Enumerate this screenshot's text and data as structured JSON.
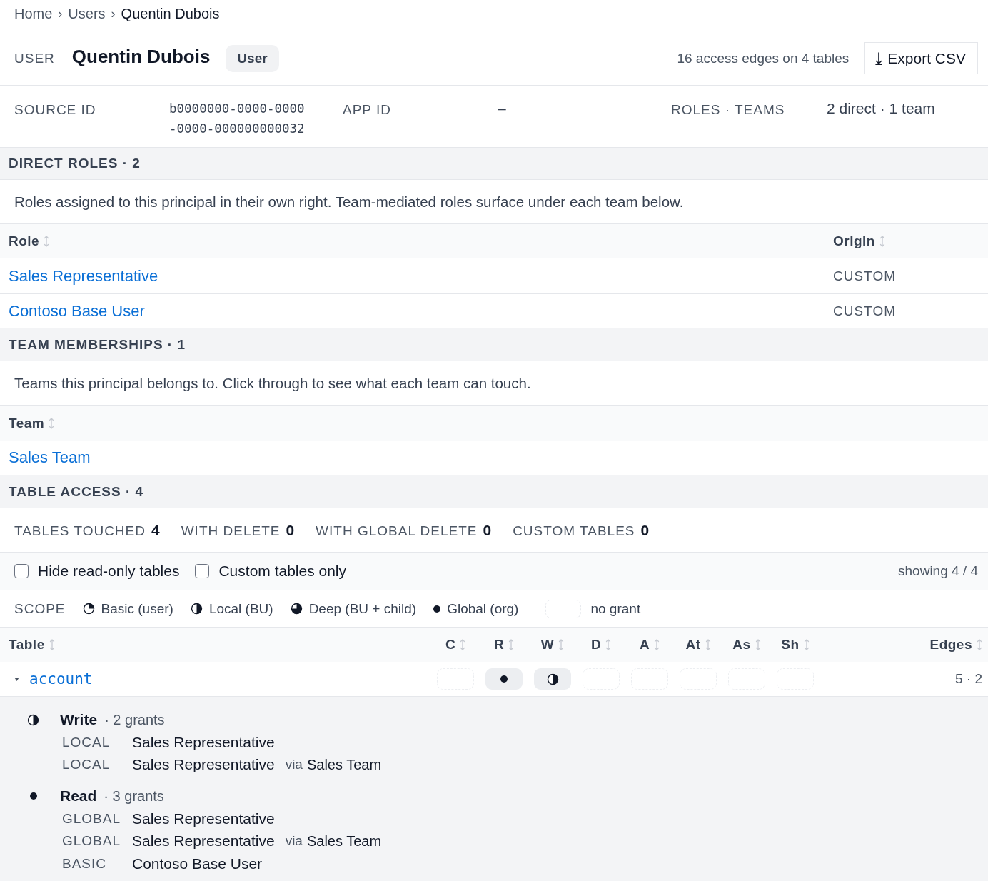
{
  "breadcrumb": [
    {
      "kind": "link",
      "label": "Home"
    },
    {
      "kind": "separator",
      "label": "›"
    },
    {
      "kind": "link",
      "label": "Users"
    },
    {
      "kind": "separator",
      "label": "›"
    },
    {
      "kind": "current",
      "label": "Quentin Dubois"
    }
  ],
  "header": {
    "type_label": "USER",
    "name": "Quentin Dubois",
    "badge": "User",
    "summary": "16 access edges on 4 tables",
    "export_button": "Export CSV"
  },
  "meta": [
    {
      "label": "SOURCE ID",
      "value": "b0000000-0000-0000-0000-000000000032",
      "kind": "mono"
    },
    {
      "label": "APP ID",
      "value": "–",
      "kind": "text"
    },
    {
      "label": "ROLES · TEAMS",
      "value": "2 direct · 1 team",
      "kind": "text"
    }
  ],
  "direct_roles": {
    "title": "DIRECT ROLES · 2",
    "description": "Roles assigned to this principal in their own right. Team-mediated roles surface under each team below.",
    "columns": [
      {
        "label": "Role"
      },
      {
        "label": "Origin"
      }
    ],
    "rows": [
      {
        "role": "Sales Representative",
        "origin": "CUSTOM"
      },
      {
        "role": "Contoso Base User",
        "origin": "CUSTOM"
      }
    ]
  },
  "team_memberships": {
    "title": "TEAM MEMBERSHIPS · 1",
    "description": "Teams this principal belongs to. Click through to see what each team can touch.",
    "columns": [
      {
        "label": "Team"
      }
    ],
    "rows": [
      {
        "team": "Sales Team"
      }
    ]
  },
  "table_access": {
    "title": "TABLE ACCESS · 4",
    "stats": [
      {
        "label": "TABLES TOUCHED",
        "value": "4"
      },
      {
        "label": "WITH DELETE",
        "value": "0"
      },
      {
        "label": "WITH GLOBAL DELETE",
        "value": "0"
      },
      {
        "label": "CUSTOM TABLES",
        "value": "0"
      }
    ],
    "filters": [
      {
        "label": "Hide read-only tables",
        "checked": false
      },
      {
        "label": "Custom tables only",
        "checked": false
      }
    ],
    "showing": "showing 4 / 4",
    "scope_legend": {
      "label": "SCOPE",
      "items": [
        {
          "kind": "basic",
          "label": "Basic (user)"
        },
        {
          "kind": "local",
          "label": "Local (BU)"
        },
        {
          "kind": "deep",
          "label": "Deep (BU + child)"
        },
        {
          "kind": "global",
          "label": "Global (org)"
        },
        {
          "kind": "none",
          "label": "no grant"
        }
      ]
    },
    "table": {
      "columns": [
        {
          "label": "Table"
        },
        {
          "label": "C"
        },
        {
          "label": "R"
        },
        {
          "label": "W"
        },
        {
          "label": "D"
        },
        {
          "label": "A"
        },
        {
          "label": "At"
        },
        {
          "label": "As"
        },
        {
          "label": "Sh"
        },
        {
          "label": "Edges"
        }
      ],
      "rows": [
        {
          "name": "account",
          "expanded": true,
          "cells": [
            {
              "kind": "none"
            },
            {
              "kind": "global"
            },
            {
              "kind": "local"
            },
            {
              "kind": "none"
            },
            {
              "kind": "none"
            },
            {
              "kind": "none"
            },
            {
              "kind": "none"
            },
            {
              "kind": "none"
            }
          ],
          "edges": "5 · 2",
          "details": [
            {
              "kind": "local",
              "privilege": "Write",
              "count": "· 2 grants",
              "grants": [
                {
                  "scope_label": "LOCAL",
                  "role": "Sales Representative"
                },
                {
                  "scope_label": "LOCAL",
                  "role": "Sales Representative",
                  "via_label": "via",
                  "via": "Sales Team"
                }
              ]
            },
            {
              "kind": "global",
              "privilege": "Read",
              "count": "· 3 grants",
              "grants": [
                {
                  "scope_label": "GLOBAL",
                  "role": "Sales Representative"
                },
                {
                  "scope_label": "GLOBAL",
                  "role": "Sales Representative",
                  "via_label": "via",
                  "via": "Sales Team"
                },
                {
                  "scope_label": "BASIC",
                  "role": "Contoso Base User"
                }
              ]
            }
          ]
        }
      ]
    }
  }
}
